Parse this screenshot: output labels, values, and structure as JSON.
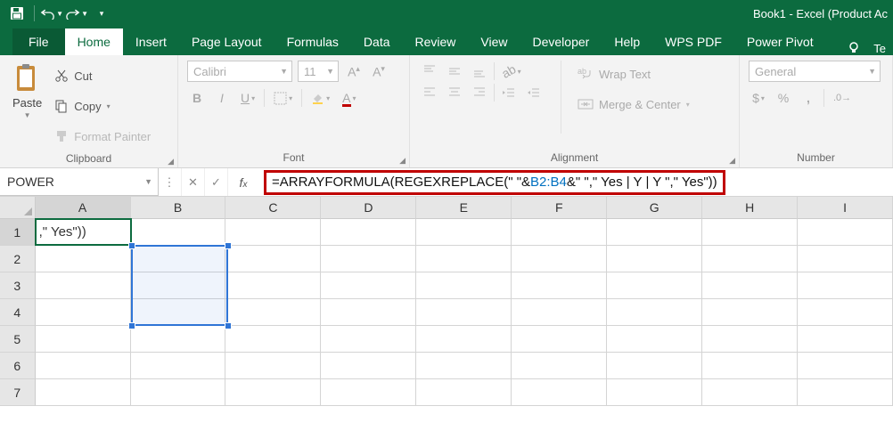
{
  "title": "Book1  -  Excel (Product Ac",
  "qat": {
    "save": "save-icon",
    "undo": "undo-icon",
    "redo": "redo-icon"
  },
  "tabs": {
    "file": "File",
    "list": [
      "Home",
      "Insert",
      "Page Layout",
      "Formulas",
      "Data",
      "Review",
      "View",
      "Developer",
      "Help",
      "WPS PDF",
      "Power Pivot"
    ],
    "active": "Home",
    "tellme": "Te"
  },
  "ribbon": {
    "clipboard": {
      "paste": "Paste",
      "cut": "Cut",
      "copy": "Copy",
      "format_painter": "Format Painter",
      "label": "Clipboard"
    },
    "font": {
      "name": "Calibri",
      "size": "11",
      "label": "Font"
    },
    "alignment": {
      "wrap": "Wrap Text",
      "merge": "Merge & Center",
      "label": "Alignment"
    },
    "number": {
      "format": "General",
      "label": "Number"
    }
  },
  "fbar": {
    "namebox": "POWER",
    "formula_prefix": "=ARRAYFORMULA(REGEXREPLACE(\" \"&",
    "formula_ref": "B2:B4",
    "formula_suffix": "&\" \",\" Yes | Y | Y \",\" Yes\"))"
  },
  "grid": {
    "cols": [
      "A",
      "B",
      "C",
      "D",
      "E",
      "F",
      "G",
      "H",
      "I"
    ],
    "rows": [
      1,
      2,
      3,
      4,
      5,
      6,
      7
    ],
    "a1_display": ",\" Yes\"))"
  }
}
